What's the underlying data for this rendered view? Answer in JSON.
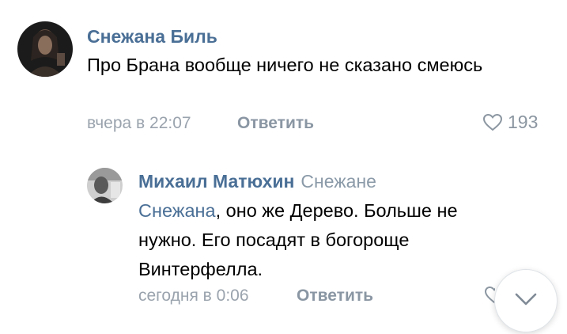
{
  "comments": [
    {
      "author": "Снежана Биль",
      "text": "Про Брана вообще ничего не сказано смеюсь",
      "time": "вчера в 22:07",
      "reply_label": "Ответить",
      "likes": "193",
      "avatar_icon": "user-avatar-icon"
    },
    {
      "author": "Михаил Матюхин",
      "reply_to": "Снежане",
      "mention": "Снежана",
      "text": ", оно же Дерево. Больше не нужно. Его посадят в богороще Винтерфелла.",
      "time": "сегодня в 0:06",
      "reply_label": "Ответить",
      "avatar_icon": "user-avatar-icon"
    }
  ],
  "scroll_button": {
    "icon": "chevron-down-icon"
  },
  "colors": {
    "link": "#4a6f96",
    "meta": "#9aa3ad",
    "text": "#000000"
  }
}
